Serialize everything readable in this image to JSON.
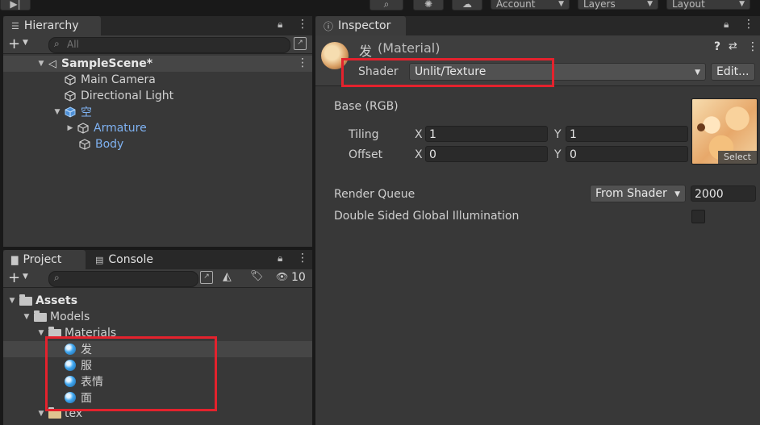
{
  "toolbar": {
    "account_label": "Account",
    "layers_label": "Layers",
    "layout_label": "Layout"
  },
  "hierarchy": {
    "tab_label": "Hierarchy",
    "search_placeholder": "All",
    "scene_name": "SampleScene*",
    "items": [
      {
        "label": "Main Camera"
      },
      {
        "label": "Directional Light"
      },
      {
        "label": "空"
      },
      {
        "label": "Armature"
      },
      {
        "label": "Body"
      }
    ]
  },
  "project": {
    "tab_project_label": "Project",
    "tab_console_label": "Console",
    "hidden_count": "10",
    "tree": {
      "assets": "Assets",
      "models": "Models",
      "materials": "Materials",
      "items": [
        {
          "label": "发"
        },
        {
          "label": "服"
        },
        {
          "label": "表情"
        },
        {
          "label": "面"
        }
      ],
      "tex": "tex"
    }
  },
  "inspector": {
    "tab_label": "Inspector",
    "material_name": "发",
    "material_type": "(Material)",
    "shader_label": "Shader",
    "shader_value": "Unlit/Texture",
    "edit_button": "Edit...",
    "base_label": "Base (RGB)",
    "tiling_label": "Tiling",
    "offset_label": "Offset",
    "x_axis": "X",
    "y_axis": "Y",
    "tiling_x": "1",
    "tiling_y": "1",
    "offset_x": "0",
    "offset_y": "0",
    "texture_select": "Select",
    "render_queue_label": "Render Queue",
    "render_queue_mode": "From Shader",
    "render_queue_value": "2000",
    "dsgi_label": "Double Sided Global Illumination"
  },
  "colors": {
    "accent_blue": "#7fb2f2",
    "highlight_red": "#e4222d",
    "panel_bg": "#383838"
  }
}
